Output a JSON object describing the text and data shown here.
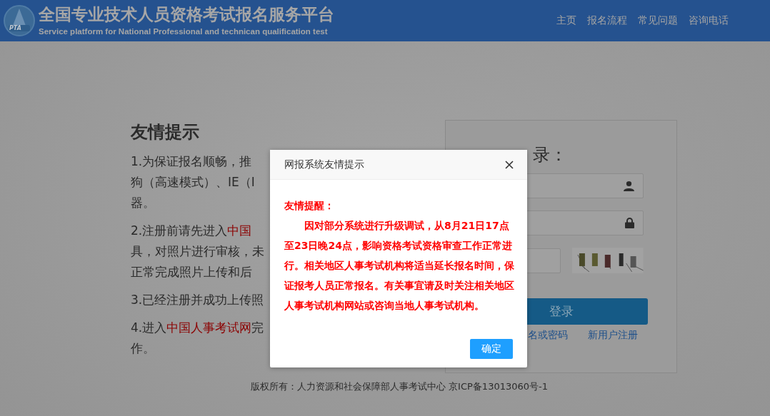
{
  "header": {
    "title": "全国专业技术人员资格考试报名服务平台",
    "subtitle": "Service platform for National Professional and technican qualification test",
    "logo_text": "PTA",
    "nav": [
      "主页",
      "报名流程",
      "常见问题",
      "咨询电话"
    ]
  },
  "tips": {
    "title": "友情提示",
    "items": [
      {
        "lines": [
          [
            {
              "text": "1.为保证报名顺畅，推",
              "link": false
            }
          ],
          [
            {
              "text": "狗（高速模式）、IE（I",
              "link": false
            }
          ],
          [
            {
              "text": "器。",
              "link": false
            }
          ]
        ]
      },
      {
        "lines": [
          [
            {
              "text": "2.注册前请先进入",
              "link": false
            },
            {
              "text": "中国",
              "link": true
            }
          ],
          [
            {
              "text": "具，对照片进行审核，未",
              "link": false
            }
          ],
          [
            {
              "text": "正常完成照片上传和后",
              "link": false
            }
          ]
        ]
      },
      {
        "lines": [
          [
            {
              "text": "3.已经注册并成功上传照",
              "link": false
            }
          ]
        ]
      },
      {
        "lines": [
          [
            {
              "text": "4.进入",
              "link": false
            },
            {
              "text": "中国人事考试网",
              "link": true
            },
            {
              "text": "完",
              "link": false
            }
          ],
          [
            {
              "text": "作。",
              "link": false
            }
          ]
        ]
      }
    ]
  },
  "login": {
    "title": "录：",
    "button": "登录",
    "links": [
      "名或密码",
      "新用户注册"
    ]
  },
  "footer": "版权所有：人力资源和社会保障部人事考试中心 京ICP备13013060号-1",
  "dialog": {
    "title": "网报系统友情提示",
    "heading": "友情提醒：",
    "body": "因对部分系统进行升级调试，从8月21日17点至23日晚24点，影响资格考试资格审查工作正常进行。相关地区人事考试机构将适当延长报名时间，保证报考人员正常报名。有关事宜请及时关注相关地区人事考试机构网站或咨询当地人事考试机构。",
    "button": "确定"
  }
}
